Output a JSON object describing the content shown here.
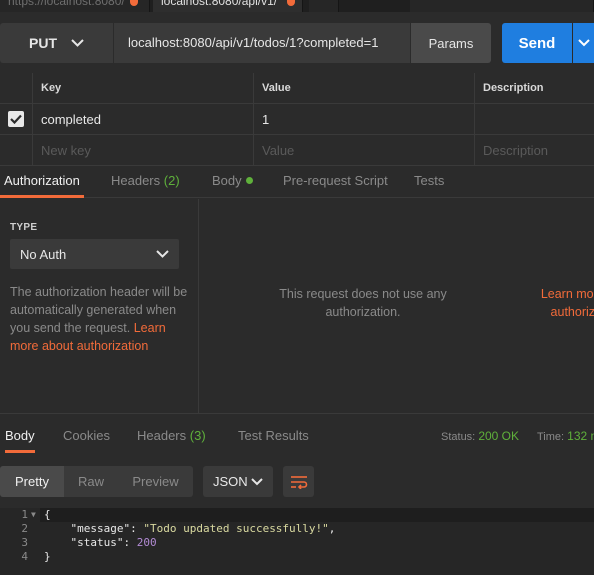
{
  "tabs": [
    {
      "title": "https://localhost:8080/",
      "modified": true
    },
    {
      "title": "localhost:8080/api/v1/",
      "modified": true
    }
  ],
  "request": {
    "method": "PUT",
    "url": "localhost:8080/api/v1/todos/1?completed=1",
    "params_label": "Params",
    "send_label": "Send"
  },
  "params": {
    "headers": [
      "Key",
      "Value",
      "Description"
    ],
    "rows": [
      {
        "checked": true,
        "key": "completed",
        "value": "1",
        "description": ""
      }
    ],
    "new_row": {
      "key": "New key",
      "value": "Value",
      "description": "Description"
    }
  },
  "request_tabs": [
    {
      "label": "Authorization",
      "active": true
    },
    {
      "label": "Headers",
      "count": "(2)"
    },
    {
      "label": "Body",
      "has_dot": true
    },
    {
      "label": "Pre-request Script"
    },
    {
      "label": "Tests"
    }
  ],
  "auth": {
    "type_label": "TYPE",
    "type_value": "No Auth",
    "description": "The authorization header will be automatically generated when you send the request.",
    "learn_link": "Learn more about authorization",
    "middle_text": "This request does not use any authorization.",
    "right_link_line1": "Learn more a",
    "right_link_line2": "authorizat"
  },
  "response": {
    "tabs": [
      {
        "label": "Body",
        "active": true
      },
      {
        "label": "Cookies"
      },
      {
        "label": "Headers",
        "count": "(3)"
      },
      {
        "label": "Test Results"
      }
    ],
    "status_label": "Status:",
    "status_value": "200 OK",
    "time_label": "Time:",
    "time_value": "132 m",
    "views": [
      "Pretty",
      "Raw",
      "Preview"
    ],
    "format": "JSON",
    "code_lines": [
      "1",
      "2",
      "3",
      "4"
    ],
    "message_key": "\"message\"",
    "message_value": "\"Todo updated successfully!\"",
    "status_key": "\"status\"",
    "status_num": "200"
  },
  "colors": {
    "accent": "#f26b3a",
    "send": "#1f7ee0",
    "success": "#5fb13b"
  }
}
